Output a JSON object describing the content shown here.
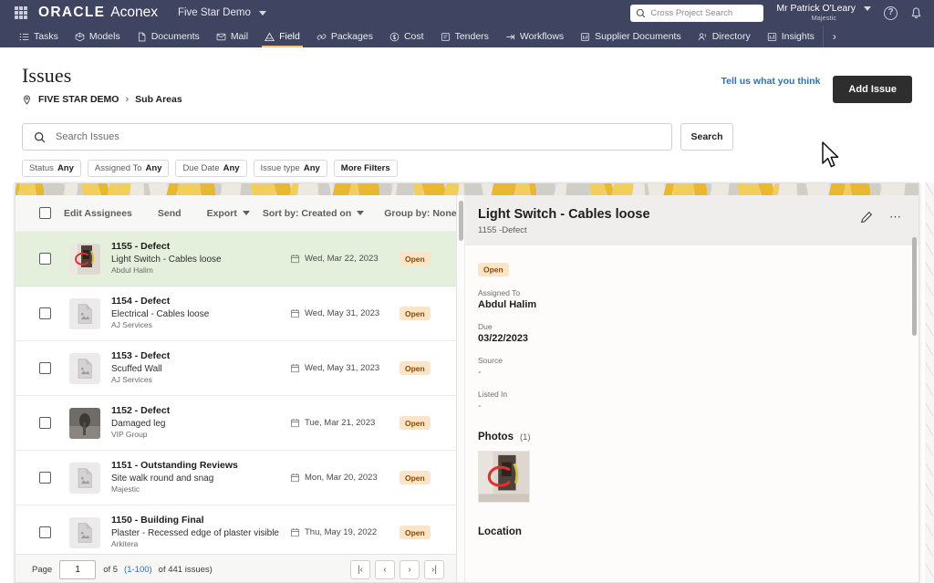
{
  "topbar": {
    "grid_icon": "grid-icon",
    "brand": "ORACLE",
    "product": "Aconex",
    "project": "Five Star Demo",
    "search_placeholder": "Cross Project Search",
    "search_value": "",
    "user_name": "Mr Patrick O'Leary",
    "user_org": "Majestic",
    "help_icon": "help-icon",
    "bell_icon": "notification-bell-icon",
    "nav": [
      {
        "label": "Tasks",
        "icon": "tasks-icon",
        "active": false
      },
      {
        "label": "Models",
        "icon": "models-icon",
        "active": false
      },
      {
        "label": "Documents",
        "icon": "documents-icon",
        "active": false
      },
      {
        "label": "Mail",
        "icon": "mail-icon",
        "active": false
      },
      {
        "label": "Field",
        "icon": "field-icon",
        "active": true
      },
      {
        "label": "Packages",
        "icon": "packages-icon",
        "active": false
      },
      {
        "label": "Cost",
        "icon": "cost-icon",
        "active": false
      },
      {
        "label": "Tenders",
        "icon": "tenders-icon",
        "active": false
      },
      {
        "label": "Workflows",
        "icon": "workflows-icon",
        "active": false
      },
      {
        "label": "Supplier Documents",
        "icon": "supplier-documents-icon",
        "active": false
      },
      {
        "label": "Directory",
        "icon": "directory-icon",
        "active": false
      },
      {
        "label": "Insights",
        "icon": "insights-icon",
        "active": false
      }
    ],
    "nav_more": "›"
  },
  "page": {
    "title": "Issues",
    "breadcrumb": {
      "pin_icon": "location-pin-icon",
      "root": "FIVE STAR DEMO",
      "separator": "›",
      "current": "Sub Areas"
    },
    "feedback_link": "Tell us what you think",
    "add_issue_button": "Add Issue"
  },
  "search": {
    "icon": "search-icon",
    "placeholder": "Search Issues",
    "value": "",
    "button": "Search",
    "filters": [
      {
        "label": "Status",
        "value": "Any"
      },
      {
        "label": "Assigned To",
        "value": "Any"
      },
      {
        "label": "Due Date",
        "value": "Any"
      },
      {
        "label": "Issue type",
        "value": "Any"
      },
      {
        "label": "More Filters",
        "value": ""
      }
    ]
  },
  "list": {
    "toolbar": {
      "select_all": "select-all-checkbox",
      "edit_assignees": "Edit Assignees",
      "send": "Send",
      "export": "Export",
      "sort_by": "Sort by: Created on",
      "group_by": "Group by: None"
    },
    "columns": [
      "id_type",
      "description",
      "organization",
      "due_date",
      "status"
    ],
    "rows": [
      {
        "id": "1155 - Defect",
        "description": "Light Switch - Cables loose",
        "org": "Abdul Halim",
        "date": "Wed, Mar 22, 2023",
        "status": "Open",
        "selected": true,
        "thumb": "photo"
      },
      {
        "id": "1154 - Defect",
        "description": "Electrical - Cables loose",
        "org": "AJ Services",
        "date": "Wed, May 31, 2023",
        "status": "Open",
        "selected": false,
        "thumb": "placeholder"
      },
      {
        "id": "1153 - Defect",
        "description": "Scuffed Wall",
        "org": "AJ Services",
        "date": "Wed, May 31, 2023",
        "status": "Open",
        "selected": false,
        "thumb": "placeholder"
      },
      {
        "id": "1152 - Defect",
        "description": "Damaged leg",
        "org": "VIP Group",
        "date": "Tue, Mar 21, 2023",
        "status": "Open",
        "selected": false,
        "thumb": "dark-photo"
      },
      {
        "id": "1151 - Outstanding Reviews",
        "description": "Site walk round and snag",
        "org": "Majestic",
        "date": "Mon, Mar 20, 2023",
        "status": "Open",
        "selected": false,
        "thumb": "placeholder"
      },
      {
        "id": "1150 - Building Final",
        "description": "Plaster - Recessed edge of plaster visible",
        "org": "Arkitera",
        "date": "Thu, May 19, 2022",
        "status": "Open",
        "selected": false,
        "thumb": "placeholder"
      }
    ],
    "pager": {
      "page_label": "Page",
      "page_value": "1",
      "of_pages": "of 5",
      "range": "(1-100)",
      "total": "of 441 issues)",
      "first": "|‹",
      "prev": "‹",
      "next": "›",
      "last": "›|"
    }
  },
  "detail": {
    "title": "Light Switch - Cables loose",
    "subtitle": "1155 -Defect",
    "edit_icon": "pencil-edit-icon",
    "more_icon": "more-options-icon",
    "status": "Open",
    "fields": [
      {
        "label": "Assigned To",
        "value": "Abdul Halim",
        "dim": false
      },
      {
        "label": "Due",
        "value": "03/22/2023",
        "dim": false
      },
      {
        "label": "Source",
        "value": "-",
        "dim": true
      },
      {
        "label": "Listed In",
        "value": "-",
        "dim": true
      }
    ],
    "photos_heading": "Photos",
    "photos_count": "(1)",
    "location_heading": "Location"
  },
  "colors": {
    "nav_bg": "#3f4460",
    "accent_tab": "#f0c674",
    "selected_row": "#e4efdc",
    "badge_bg": "#fbe4c7",
    "badge_text": "#8a4b00",
    "link": "#2f6fb5",
    "button_dark": "#2e2e2e"
  }
}
